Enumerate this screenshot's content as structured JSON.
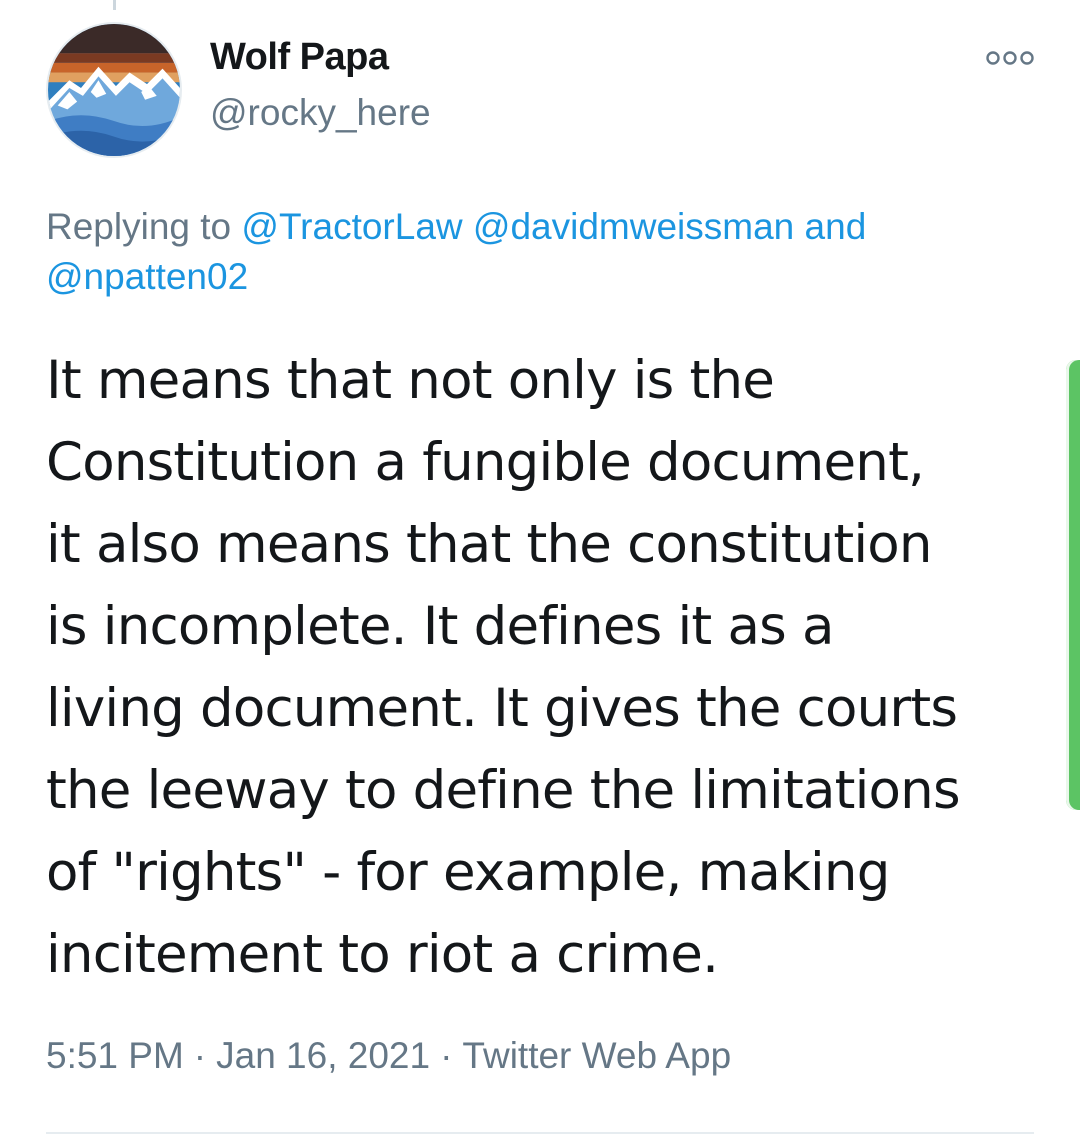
{
  "tweet": {
    "author": {
      "display_name": "Wolf Papa",
      "handle": "@rocky_here",
      "avatar_icon": "mountain-avatar"
    },
    "more_icon": "more-options-icon",
    "reply": {
      "prefix": "Replying to",
      "mentions": [
        "@TractorLaw",
        "@davidmweissman"
      ],
      "conjunction": "and",
      "last_mention": "@npatten02"
    },
    "text_lines": [
      "It means that not only is the",
      "Constitution a fungible document,",
      "it also means that the constitution",
      "is incomplete. It defines it as a",
      "living document. It gives the courts",
      "the leeway to define the limitations",
      "of \"rights\" - for example, making",
      "incitement to riot a crime."
    ],
    "time": "5:51 PM",
    "date": "Jan 16, 2021",
    "separator": "·",
    "source": "Twitter Web App"
  },
  "colors": {
    "text": "#14171a",
    "secondary": "#657786",
    "link": "#1b95e0",
    "divider": "#e6ecf0",
    "scroll_indicator": "#5cc464"
  }
}
